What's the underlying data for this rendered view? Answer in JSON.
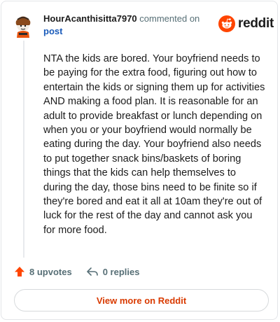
{
  "comment": {
    "username": "HourAcanthisitta7970",
    "meta_action": "commented on",
    "meta_target": "post",
    "body": "NTA the kids are bored. Your boyfriend needs to be paying for the extra food, figuring out how to entertain the kids or signing them up for activities AND making a food plan. It is reasonable for an adult to provide breakfast or lunch depending on when you or your boyfriend would normally be eating during the day. Your boyfriend also needs to put together snack bins/baskets of boring things that the kids can help themselves to during the day, those bins need to be finite so if they're bored and eat it all at 10am they're out of luck for the rest of the day and cannot ask you for more food."
  },
  "brand": {
    "name": "reddit",
    "icon": "reddit-logo-icon",
    "color": "#ff4500"
  },
  "actions": {
    "upvotes_label": "8 upvotes",
    "replies_label": "0 replies",
    "upvote_icon": "upvote-arrow-icon",
    "reply_icon": "reply-arrow-icon"
  },
  "footer": {
    "view_more_label": "View more on Reddit"
  },
  "colors": {
    "accent": "#d93a00",
    "upvote": "#ff4500",
    "link": "#1a5bba",
    "muted": "#576f76"
  }
}
